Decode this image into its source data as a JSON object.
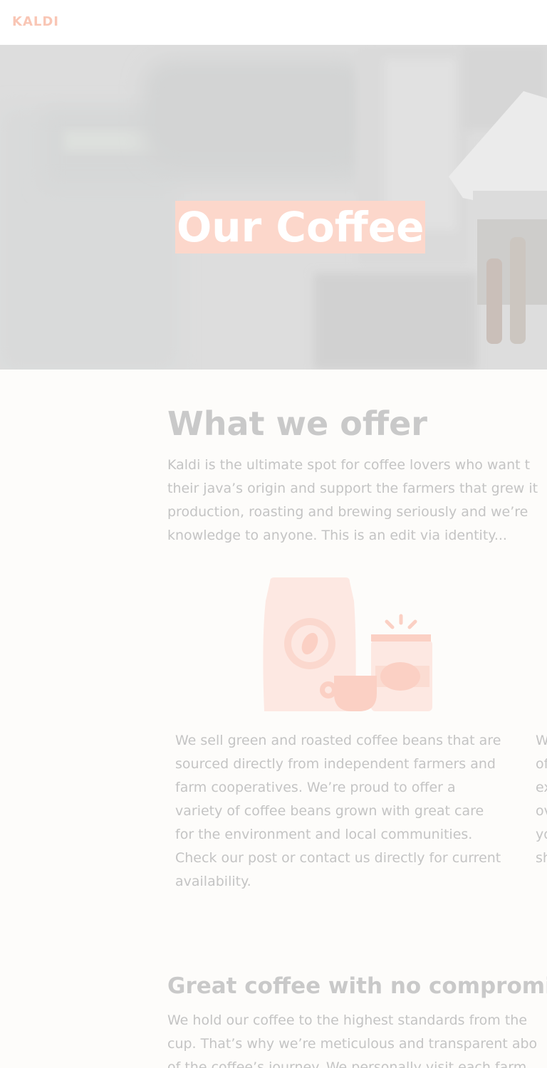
{
  "nav": {
    "logo": "KALDI"
  },
  "hero": {
    "title": "Our Coffee"
  },
  "offer": {
    "heading": "What we offer",
    "lines": [
      "Kaldi is the ultimate spot for coffee lovers who want t",
      "their java’s origin and support the farmers that grew it",
      "production, roasting and brewing seriously and we’re",
      "knowledge to anyone. This is an edit via identity..."
    ]
  },
  "feature_1": {
    "lines": [
      "We sell green and roasted coffee beans that are",
      "sourced directly from independent farmers and",
      "farm cooperatives. We’re proud to offer a",
      "variety of coffee beans grown with great care",
      "for the environment and local communities.",
      "Check our post or contact us directly for current",
      "availability."
    ]
  },
  "feature_2": {
    "lines": [
      "W",
      "of",
      "ex",
      "ov",
      "yo",
      "sh"
    ]
  },
  "no_compromises": {
    "heading": "Great coffee with no compromises",
    "lines": [
      "We hold our coffee to the highest standards from the",
      "cup. That’s why we’re meticulous and transparent abo",
      "of the coffee’s journey. We personally visit each farm"
    ]
  },
  "colors": {
    "accent": "#fcd7cb",
    "logo": "#f9c6b5",
    "text": "#c4c4c4",
    "heading": "#c9c9c9",
    "page_background": "#fdfcfa"
  },
  "icons": {
    "illustration": "coffee-bag-cup-jar-illustration"
  }
}
